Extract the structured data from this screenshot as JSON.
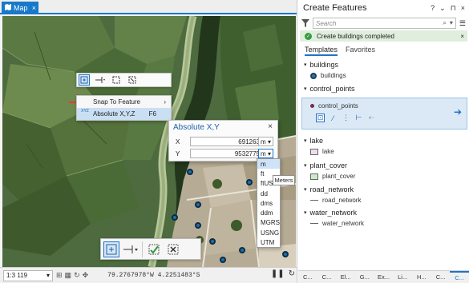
{
  "map": {
    "tab_label": "Map",
    "tab_close": "×",
    "scale_value": "1:3 119",
    "coordinate_readout": "79.2767978°W 4.2251483°S",
    "mini_toolbar": {
      "icons": [
        "absolute-xyz-icon",
        "segment-length-icon",
        "midpoint-icon",
        "rectangle-icon"
      ]
    },
    "context_menu": {
      "snap_to_feature": "Snap To Feature",
      "snap_arrow": "›",
      "absolute_xyz": "Absolute X,Y,Z",
      "absolute_xyz_shortcut": "F6",
      "absolute_xyz_icon_text": "XYZ"
    },
    "xyz_dialog": {
      "title": "Absolute X,Y",
      "close": "×",
      "x_label": "X",
      "x_value": "691263",
      "x_unit": "m",
      "y_label": "Y",
      "y_value": "9532775",
      "y_unit": "m"
    },
    "unit_options": [
      "m",
      "ft",
      "ftUS",
      "dd",
      "dms",
      "ddm",
      "MGRS",
      "USNG",
      "UTM"
    ],
    "unit_selected": "m",
    "tooltip": "Meters"
  },
  "panel": {
    "title": "Create Features",
    "header_icons": [
      "?",
      "⌄",
      "⊓",
      "×"
    ],
    "search_placeholder": "Search",
    "success_message": "Create buildings completed",
    "success_close": "×",
    "tabs": [
      "Templates",
      "Favorites"
    ],
    "layers": [
      {
        "name": "buildings",
        "template": "buildings",
        "swatch": "point",
        "color": "#2b7aa3"
      },
      {
        "name": "control_points",
        "template": "control_points",
        "swatch": "dot",
        "color": "#7a2b4a"
      },
      {
        "name": "lake",
        "template": "lake",
        "swatch": "poly",
        "color": "#f1dcef"
      },
      {
        "name": "plant_cover",
        "template": "plant_cover",
        "swatch": "poly",
        "color": "#c7ecc6"
      },
      {
        "name": "road_network",
        "template": "road_network",
        "swatch": "line",
        "color": "#666666"
      },
      {
        "name": "water_network",
        "template": "water_network",
        "swatch": "line",
        "color": "#666666"
      }
    ],
    "bottom_tabs": [
      "C...",
      "C...",
      "El...",
      "G...",
      "Ex...",
      "Li...",
      "H...",
      "C...",
      "C..."
    ]
  },
  "colors": {
    "accent": "#1879c9",
    "success_bg": "#dfeedd",
    "selection_bg": "#dbe9f7"
  }
}
